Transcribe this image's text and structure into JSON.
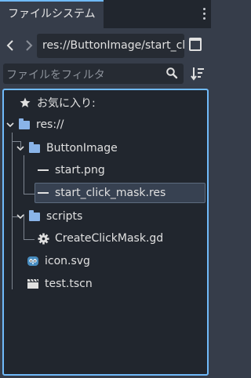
{
  "dock": {
    "tab_label": "ファイルシステム",
    "menu_icon": "kebab-menu-icon"
  },
  "nav": {
    "back_icon": "chevron-left-icon",
    "forward_icon": "chevron-right-icon",
    "path_value": "res://ButtonImage/start_cl",
    "split_icon": "split-view-icon"
  },
  "filter": {
    "placeholder": "ファイルをフィルタ",
    "search_icon": "search-icon",
    "sort_icon": "sort-icon"
  },
  "tree": {
    "favorites": "お気に入り:",
    "root": "res://",
    "items": [
      {
        "label": "ButtonImage",
        "type": "folder"
      },
      {
        "label": "start.png",
        "type": "image"
      },
      {
        "label": "start_click_mask.res",
        "type": "resource",
        "selected": true
      },
      {
        "label": "scripts",
        "type": "folder"
      },
      {
        "label": "CreateClickMask.gd",
        "type": "script"
      },
      {
        "label": "icon.svg",
        "type": "svg"
      },
      {
        "label": "test.tscn",
        "type": "scene"
      }
    ]
  },
  "colors": {
    "accent": "#70bafa",
    "folder": "#8ab4e8",
    "background": "#363d4a",
    "panel": "#21262e"
  }
}
